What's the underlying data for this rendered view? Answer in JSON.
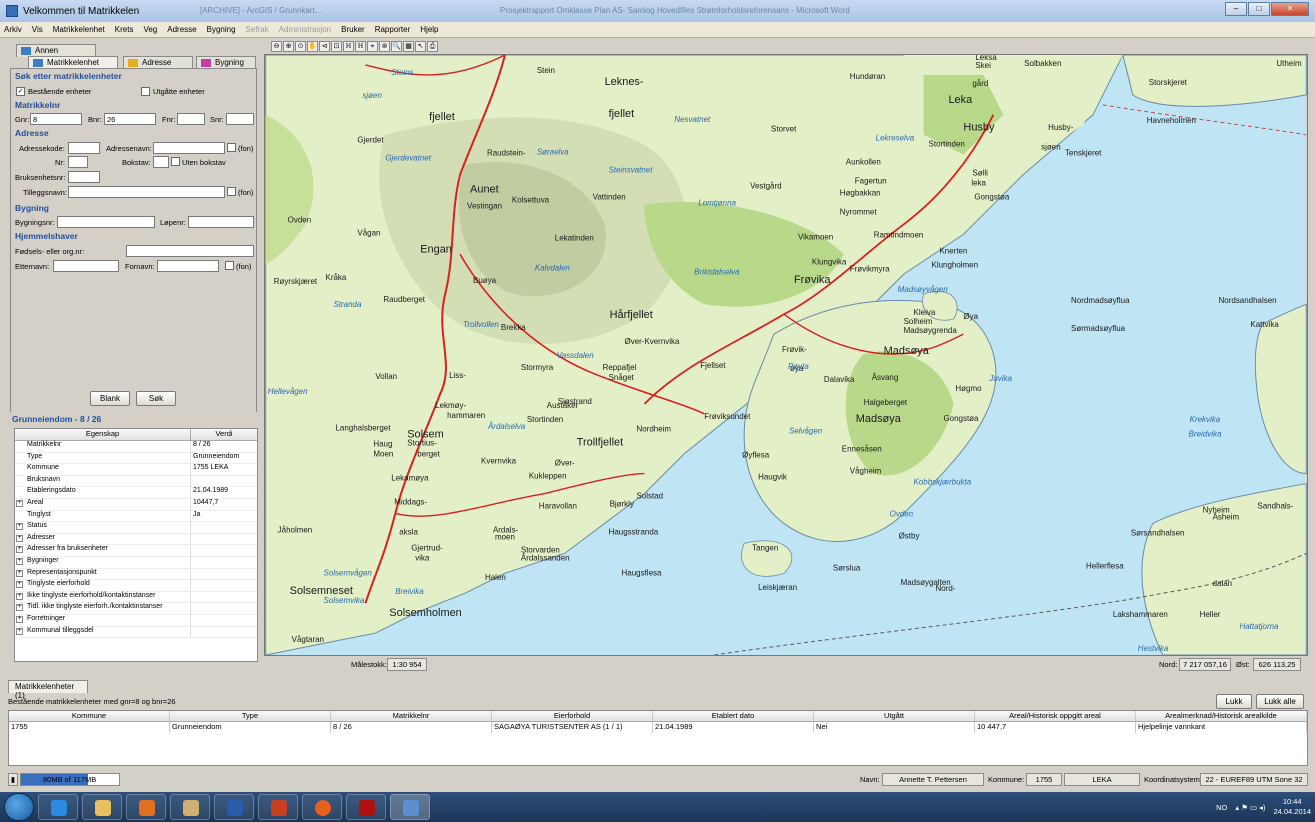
{
  "window": {
    "title": "Velkommen til Matrikkelen",
    "faded_text_1": "[ARCHIVE] - ArcGIS / Grunnkart...",
    "faded_text_2": "Prosjektrapport Omklasse Plan AS- Samlog Hovedfiles Strømforholdsreforensans - Microsoft Word",
    "min": "–",
    "max": "□",
    "close": "✕"
  },
  "menu": [
    {
      "label": "Arkiv",
      "enabled": true
    },
    {
      "label": "Vis",
      "enabled": true
    },
    {
      "label": "Matrikkelenhet",
      "enabled": true
    },
    {
      "label": "Krets",
      "enabled": true
    },
    {
      "label": "Veg",
      "enabled": true
    },
    {
      "label": "Adresse",
      "enabled": true
    },
    {
      "label": "Bygning",
      "enabled": true
    },
    {
      "label": "Sefrak",
      "enabled": false
    },
    {
      "label": "Administrasjon",
      "enabled": false
    },
    {
      "label": "Bruker",
      "enabled": true
    },
    {
      "label": "Rapporter",
      "enabled": true
    },
    {
      "label": "Hjelp",
      "enabled": true
    }
  ],
  "search": {
    "tab_other": "Annen kommune",
    "tabs": [
      "Matrikkelenhet",
      "Adresse",
      "Bygning"
    ],
    "header": "Søk etter matrikkelenheter",
    "chk_existing": "Bestående enheter",
    "chk_existing_checked": "✓",
    "chk_expired": "Utgåtte enheter",
    "sec_matrikkelnr": "Matrikkelnr",
    "gnr_label": "Gnr:",
    "gnr_value": "8",
    "bnr_label": "Bnr:",
    "bnr_value": "26",
    "fnr_label": "Fnr:",
    "snr_label": "Snr:",
    "sec_adresse": "Adresse",
    "adressekode_label": "Adressekode:",
    "adressenavn_label": "Adressenavn:",
    "fon": "(fon)",
    "nr_label": "Nr:",
    "bokstav_label": "Bokstav:",
    "uten_bokstav": "Uten bokstav",
    "bruksenhetsnr_label": "Bruksenhetsnr:",
    "tilleggsnavn_label": "Tilleggsnavn:",
    "sec_bygning": "Bygning",
    "bygningsnr_label": "Bygningsnr:",
    "lopenr_label": "Løpenr:",
    "sec_hjemmel": "Hjemmelshaver",
    "fodsel_label": "Fødsels- eller org.nr:",
    "etternavn_label": "Etternavn:",
    "fornavn_label": "Fornavn:",
    "blank_btn": "Blank",
    "sok_btn": "Søk"
  },
  "properties": {
    "title": "Grunneiendom - 8 / 26",
    "col1": "Egenskap",
    "col2": "Verdi",
    "rows": [
      {
        "k": "Matrikkelnr",
        "v": "8 / 26",
        "x": ""
      },
      {
        "k": "Type",
        "v": "Grunneiendom",
        "x": ""
      },
      {
        "k": "Kommune",
        "v": "1755  LEKA",
        "x": ""
      },
      {
        "k": "Bruksnavn",
        "v": "",
        "x": ""
      },
      {
        "k": "Etableringsdato",
        "v": "21.04.1989",
        "x": ""
      },
      {
        "k": "Areal",
        "v": "10447,7",
        "x": "+"
      },
      {
        "k": "Tinglyst",
        "v": "Ja",
        "x": ""
      },
      {
        "k": "Status",
        "v": "",
        "x": "+"
      },
      {
        "k": "Adresser",
        "v": "",
        "x": "+"
      },
      {
        "k": "Adresser fra bruksenheter",
        "v": "",
        "x": "+"
      },
      {
        "k": "Bygninger",
        "v": "",
        "x": "+"
      },
      {
        "k": "Representasjonspunkt",
        "v": "",
        "x": "+"
      },
      {
        "k": "Tinglyste eierforhold",
        "v": "",
        "x": "+"
      },
      {
        "k": "Ikke tinglyste eierforhold/kontaktinstanser",
        "v": "",
        "x": "+"
      },
      {
        "k": "Tidl. ikke tinglyste eierforh./kontaktinstanser",
        "v": "",
        "x": "+"
      },
      {
        "k": "Forretninger",
        "v": "",
        "x": "+"
      },
      {
        "k": "Kommunal tilleggsdel",
        "v": "",
        "x": "+"
      }
    ]
  },
  "map": {
    "scale_label": "Målestokk:",
    "scale_value": "1:30 954",
    "nord_label": "Nord:",
    "nord_value": "7 217 057,16",
    "ost_label": "Øst:",
    "ost_value": "626 113,25",
    "tools": [
      "⊖",
      "⊕",
      "⊙",
      "✋",
      "⊲",
      "⊡",
      "ℍ",
      "ℍ",
      "⌖",
      "⊛",
      "🔍",
      "▦",
      "↖",
      "⎙"
    ],
    "places": [
      {
        "t": "Stein"
      },
      {
        "t": "Leknes-"
      },
      {
        "t": "fjellet"
      },
      {
        "t": "Hundøran"
      },
      {
        "t": "Leka"
      },
      {
        "t": "Husby"
      },
      {
        "t": "Husby-"
      },
      {
        "t": "sjøen"
      },
      {
        "t": "Storskjeret"
      },
      {
        "t": "Havneholmen"
      },
      {
        "t": "Tenskjeret"
      },
      {
        "t": "Stortinden"
      },
      {
        "t": "Gjerdet"
      },
      {
        "t": "Aunet"
      },
      {
        "t": "Kolsettuva"
      },
      {
        "t": "Vattinden"
      },
      {
        "t": "Storvet"
      },
      {
        "t": "Vestgård"
      },
      {
        "t": "Sølli"
      },
      {
        "t": "Gongstøa"
      },
      {
        "t": "Vågan"
      },
      {
        "t": "Engan"
      },
      {
        "t": "Lekatinden"
      },
      {
        "t": "Frøvika"
      },
      {
        "t": "Knerten"
      },
      {
        "t": "Klungholmen"
      },
      {
        "t": "Raudberget"
      },
      {
        "t": "Hårfjellet"
      },
      {
        "t": "Madsøygrenda"
      },
      {
        "t": "Nordmadsøyflua"
      },
      {
        "t": "Sørmadsøyflua"
      },
      {
        "t": "Nordsandhalsen"
      },
      {
        "t": "Kattvika"
      },
      {
        "t": "Frøvik-"
      },
      {
        "t": "øya"
      },
      {
        "t": "Madsøya"
      },
      {
        "t": "Frøviksundet"
      },
      {
        "t": "Solsem"
      },
      {
        "t": "Madsøya"
      },
      {
        "t": "Gongstøa"
      },
      {
        "t": "Øyflesa"
      },
      {
        "t": "Haugvik"
      },
      {
        "t": "Ennesåsen"
      },
      {
        "t": "Middags-"
      },
      {
        "t": "aksla"
      },
      {
        "t": "Haugsstranda"
      },
      {
        "t": "Haugsflesa"
      },
      {
        "t": "Tangen"
      },
      {
        "t": "Sørslua"
      },
      {
        "t": "Madsøygalten"
      },
      {
        "t": "Sørsandhalsen"
      },
      {
        "t": "Hellerflesa"
      },
      {
        "t": "Lakshammaren"
      },
      {
        "t": "Heller"
      },
      {
        "t": "Solsemneset"
      },
      {
        "t": "Solsemholmen"
      },
      {
        "t": "Vågtaran"
      },
      {
        "t": "Leiskjæran"
      },
      {
        "t": "Halen"
      },
      {
        "t": "Øver-Kvernvika"
      },
      {
        "t": "Fjellset"
      },
      {
        "t": "Sjøstrand"
      },
      {
        "t": "Nordheim"
      },
      {
        "t": "Stormyra"
      },
      {
        "t": "Stortinden"
      },
      {
        "t": "Kukleppen"
      },
      {
        "t": "Haravollan"
      },
      {
        "t": "Bjørkly"
      },
      {
        "t": "Ardals-"
      },
      {
        "t": "moen"
      },
      {
        "t": "Storvarden"
      },
      {
        "t": "Årdalssanden"
      },
      {
        "t": "Gjertrud-"
      },
      {
        "t": "vika"
      },
      {
        "t": "Jåholmen"
      },
      {
        "t": "Lekamøya"
      },
      {
        "t": "Brekka"
      },
      {
        "t": "Liss-"
      },
      {
        "t": "Vollan"
      },
      {
        "t": "Langhalsberget"
      },
      {
        "t": "Røyrskjæret"
      },
      {
        "t": "Kråka"
      },
      {
        "t": "Ovden"
      },
      {
        "t": "Buøya"
      },
      {
        "t": "Vestingan"
      },
      {
        "t": "Raudstein-"
      },
      {
        "t": "fjellet"
      },
      {
        "t": "Aunkollen"
      },
      {
        "t": "Fagertun"
      },
      {
        "t": "Høgbakkan"
      },
      {
        "t": "Nyrommet"
      },
      {
        "t": "Ramtindmoen"
      },
      {
        "t": "Vikamoen"
      },
      {
        "t": "Klungvika"
      },
      {
        "t": "Frøvikmyra"
      },
      {
        "t": "Kleiva"
      },
      {
        "t": "Solheim"
      },
      {
        "t": "Øya"
      },
      {
        "t": "Åsvang"
      },
      {
        "t": "Dalavika"
      },
      {
        "t": "Halgeberget"
      },
      {
        "t": "Høgmo"
      },
      {
        "t": "Vågheim"
      },
      {
        "t": "Nyheim"
      },
      {
        "t": "Åsheim"
      },
      {
        "t": "Sandhals-"
      },
      {
        "t": "dalan"
      },
      {
        "t": "Reppafjel"
      },
      {
        "t": "Snåget"
      },
      {
        "t": "Øver-"
      },
      {
        "t": "Kvernvika"
      },
      {
        "t": "Solstad"
      },
      {
        "t": "Trollfjellet"
      },
      {
        "t": "Haug"
      },
      {
        "t": "Moen"
      },
      {
        "t": "Stortius-"
      },
      {
        "t": "berget"
      },
      {
        "t": "Lekmøy-"
      },
      {
        "t": "hammaren"
      },
      {
        "t": "Auståker"
      },
      {
        "t": "leka"
      },
      {
        "t": "Utheim"
      },
      {
        "t": "Solbakken"
      },
      {
        "t": "Leksa"
      },
      {
        "t": "Skei"
      },
      {
        "t": "Østby"
      },
      {
        "t": "Nord-"
      },
      {
        "t": "gård"
      }
    ],
    "water": [
      {
        "t": "Steins"
      },
      {
        "t": "sjøen"
      },
      {
        "t": "Gjerdevatnet"
      },
      {
        "t": "Nesvatnet"
      },
      {
        "t": "Søraelva"
      },
      {
        "t": "Steinsvatnet"
      },
      {
        "t": "Lomtjønna"
      },
      {
        "t": "Briktdalselva"
      },
      {
        "t": "Madsøyvågen"
      },
      {
        "t": "Juvika"
      },
      {
        "t": "Krekvika"
      },
      {
        "t": "Breidvika"
      },
      {
        "t": "Kobbskjærbukta"
      },
      {
        "t": "Ovden"
      },
      {
        "t": "Hattatjorna"
      },
      {
        "t": "Hestvika"
      },
      {
        "t": "Breivika"
      },
      {
        "t": "Solsemvika"
      },
      {
        "t": "Solsemvågen"
      },
      {
        "t": "Selvågen"
      },
      {
        "t": "Pøyta"
      },
      {
        "t": "Årdalselva"
      },
      {
        "t": "Lekreselva"
      },
      {
        "t": "Vassdalen"
      },
      {
        "t": "Kalvdalen"
      },
      {
        "t": "Trollvollen"
      },
      {
        "t": "Stranda"
      },
      {
        "t": "Hellevågen"
      }
    ]
  },
  "bottom": {
    "tab": "Matrikkelenheter (1)",
    "caption": "Bestående matrikkelenheter med gnr=8 og  bnr=26",
    "lukk": "Lukk",
    "lukk_alle": "Lukk alle",
    "columns": [
      "Kommune",
      "Type",
      "Matrikkelnr",
      "Eierforhold",
      "Etablert dato",
      "Utgått",
      "Areal/Historisk oppgitt areal",
      "Arealmerknad/Historisk arealkilde"
    ],
    "rows": [
      [
        "1755",
        "Grunneiendom",
        "8 / 26",
        "SAGAØYA TURISTSENTER AS (1 / 1)",
        "21.04.1989",
        "Nei",
        "10 447,7",
        "Hjelpelinje vannkant"
      ]
    ]
  },
  "status": {
    "memory": "80MB of 117MB",
    "memory_pct": 0.68,
    "navn_label": "Navn:",
    "navn_value": "Annette T. Pettersen",
    "kommune_label": "Kommune:",
    "kommune_nr": "1755",
    "kommune_navn": "LEKA",
    "koord_label": "Koordinatsystem:",
    "koord_value": "22 - EUREF89 UTM Sone 32"
  },
  "taskbar": {
    "lang": "NO",
    "time": "10:44",
    "date": "24.04.2014"
  },
  "colors": {
    "sea": "#bfe4f4",
    "land": "#e3efc6",
    "road": "#d82020",
    "accent_blue": "#2050a0"
  }
}
